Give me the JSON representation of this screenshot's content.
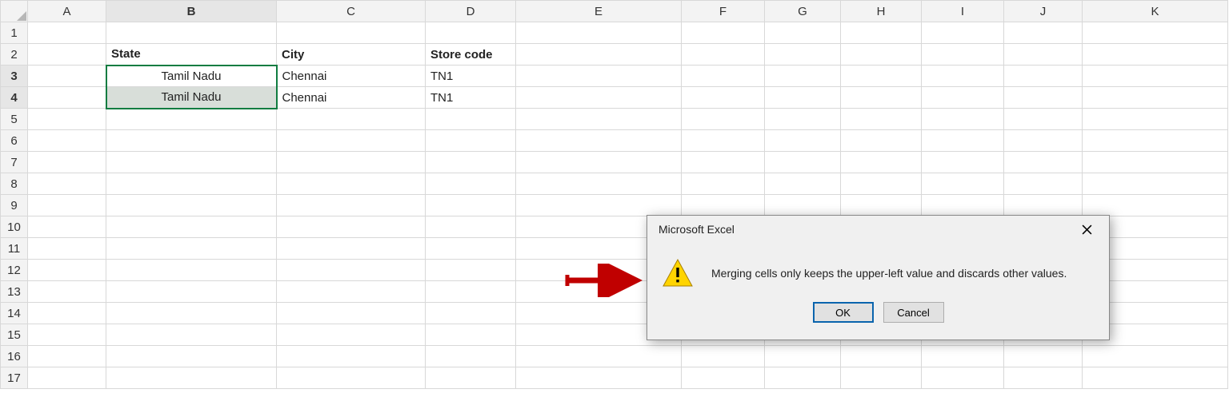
{
  "columns": [
    "A",
    "B",
    "C",
    "D",
    "E",
    "F",
    "G",
    "H",
    "I",
    "J",
    "K"
  ],
  "rows": [
    "1",
    "2",
    "3",
    "4",
    "5",
    "6",
    "7",
    "8",
    "9",
    "10",
    "11",
    "12",
    "13",
    "14",
    "15",
    "16",
    "17"
  ],
  "cells": {
    "B2": "State",
    "C2": "City",
    "D2": "Store code",
    "B3": "Tamil Nadu",
    "C3": "Chennai",
    "D3": "TN1",
    "B4": "Tamil Nadu",
    "C4": "Chennai",
    "D4": "TN1"
  },
  "dialog": {
    "title": "Microsoft Excel",
    "message": "Merging cells only keeps the upper-left value and discards other values.",
    "ok": "OK",
    "cancel": "Cancel"
  }
}
